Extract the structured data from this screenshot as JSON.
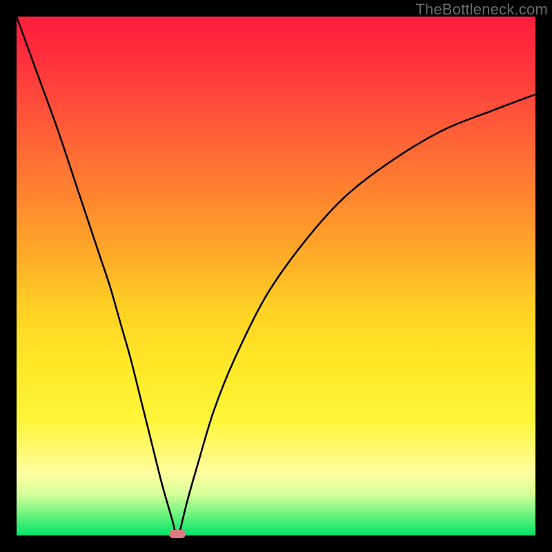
{
  "watermark": "TheBottleneck.com",
  "chart_data": {
    "type": "line",
    "title": "",
    "xlabel": "",
    "ylabel": "",
    "xlim": [
      0,
      100
    ],
    "ylim": [
      0,
      100
    ],
    "grid": false,
    "legend": false,
    "background_gradient": {
      "direction": "vertical",
      "stops": [
        {
          "pos": 0.0,
          "color": "#ff1e3c"
        },
        {
          "pos": 0.25,
          "color": "#ff6a35"
        },
        {
          "pos": 0.5,
          "color": "#ffc024"
        },
        {
          "pos": 0.78,
          "color": "#fff63a"
        },
        {
          "pos": 0.92,
          "color": "#d7ff9a"
        },
        {
          "pos": 1.0,
          "color": "#00e36a"
        }
      ]
    },
    "series": [
      {
        "name": "bottleneck-curve",
        "color": "#000000",
        "x": [
          0,
          4,
          8,
          12,
          16,
          18,
          20,
          22,
          24,
          26,
          28,
          30,
          30.5,
          31,
          31.5,
          32,
          33,
          35,
          38,
          42,
          48,
          55,
          63,
          72,
          82,
          92,
          100
        ],
        "y": [
          100,
          89,
          78,
          66,
          54,
          48,
          41,
          34,
          26,
          18,
          10,
          3,
          1,
          0.4,
          1,
          3,
          7,
          14,
          24,
          34,
          46,
          56,
          65,
          72,
          78,
          82,
          85
        ]
      }
    ],
    "annotations": [
      {
        "name": "min-marker",
        "shape": "rounded-rect",
        "x": 31,
        "y": 0.2,
        "color": "#e07a80"
      }
    ],
    "notes": "V-shaped bottleneck curve on a vertical red→yellow→green gradient. Minimum (optimal point) at roughly x≈31, y≈0. No axes, ticks, or labels are rendered."
  }
}
